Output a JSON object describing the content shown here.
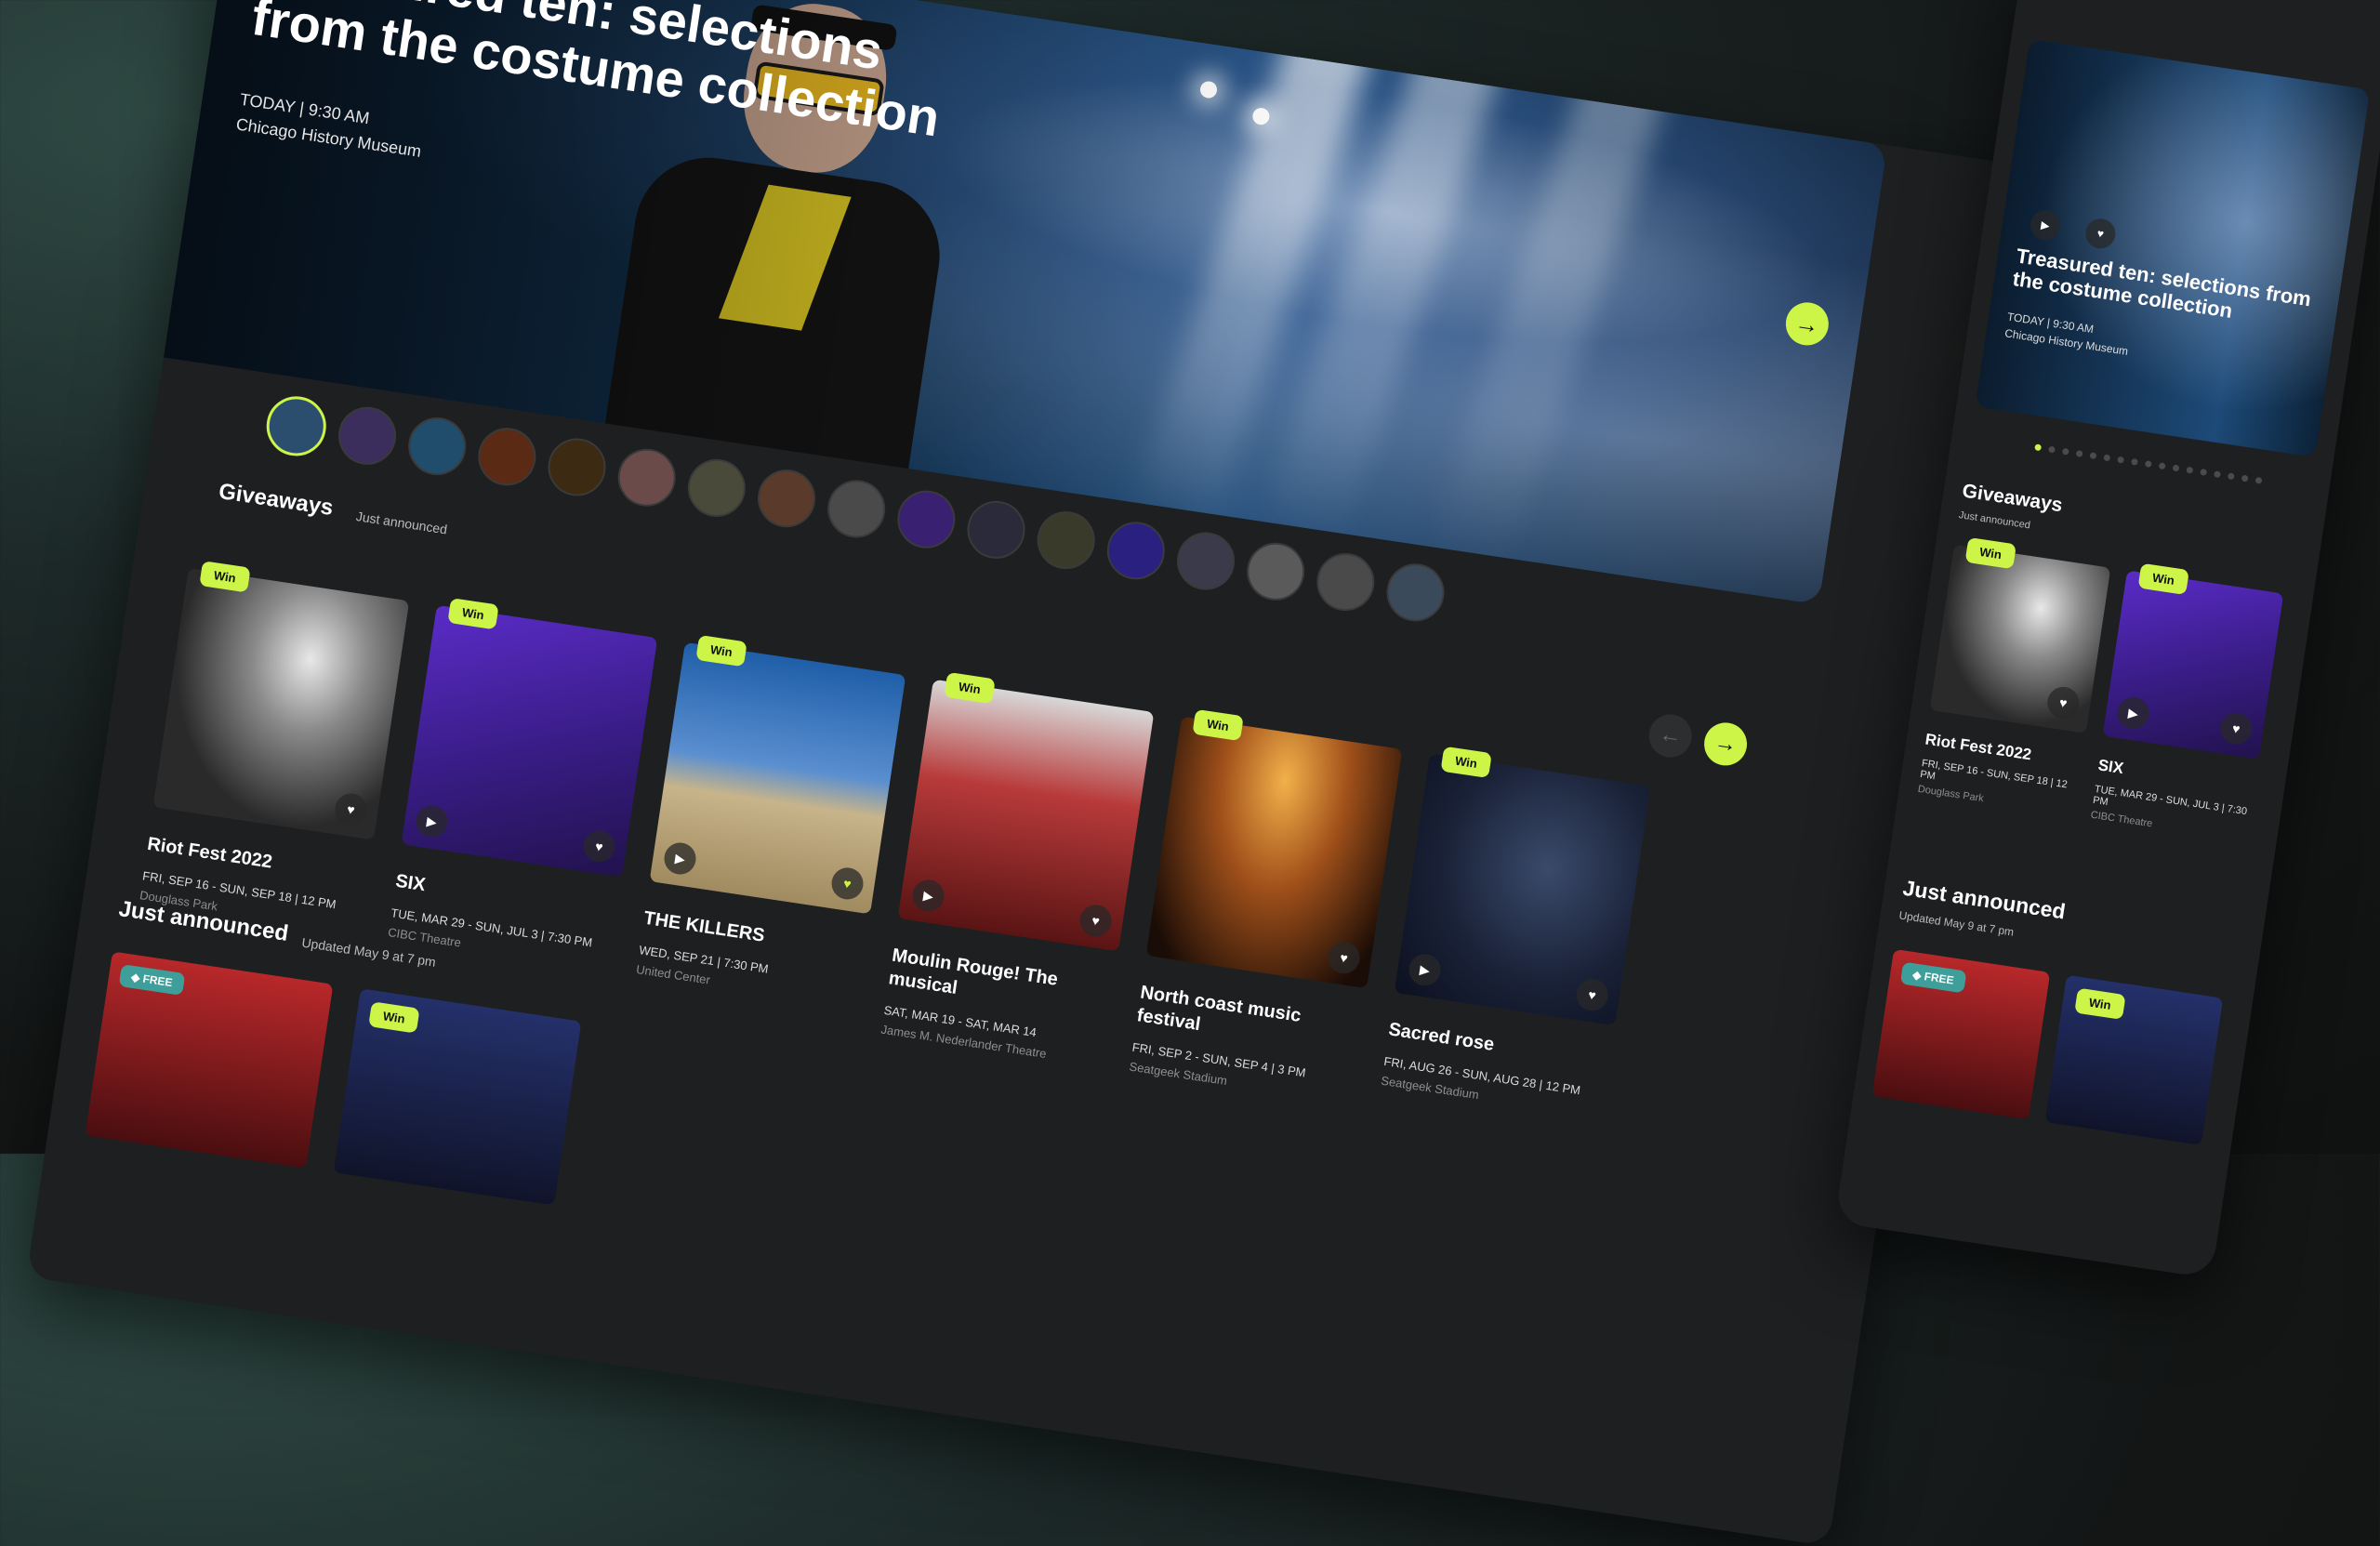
{
  "hero": {
    "title": "Treasured ten: selections from the costume collection",
    "datetime": "TODAY | 9:30 AM",
    "venue": "Chicago History Museum",
    "next_icon": "arrow-right-icon"
  },
  "giveaways": {
    "title": "Giveaways",
    "subtitle": "Just announced",
    "badge": "Win",
    "cards": [
      {
        "name": "Riot Fest 2022",
        "date": "FRI, SEP 16 - SUN, SEP 18 | 12 PM",
        "venue": "Douglass Park"
      },
      {
        "name": "SIX",
        "date": "TUE, MAR 29 - SUN, JUL 3 | 7:30 PM",
        "venue": "CIBC Theatre"
      },
      {
        "name": "THE KILLERS",
        "date": "WED, SEP 21 | 7:30 PM",
        "venue": "United Center"
      },
      {
        "name": "Moulin Rouge! The musical",
        "date": "SAT, MAR 19 - SAT, MAR 14",
        "venue": "James M. Nederlander Theatre"
      },
      {
        "name": "North coast music festival",
        "date": "FRI, SEP 2 - SUN, SEP 4 | 3 PM",
        "venue": "Seatgeek Stadium"
      },
      {
        "name": "Sacred rose",
        "date": "FRI, AUG 26 - SUN, AUG 28 | 12 PM",
        "venue": "Seatgeek Stadium"
      }
    ]
  },
  "just_announced": {
    "title": "Just announced",
    "subtitle": "Updated May 9 at 7 pm",
    "free_badge": "FREE",
    "win_badge": "Win"
  },
  "mobile": {
    "hero_title": "Treasured ten: selections from the costume collection",
    "hero_datetime": "TODAY | 9:30 AM",
    "hero_venue": "Chicago History Museum",
    "giveaways_title": "Giveaways",
    "giveaways_subtitle": "Just announced",
    "cards": [
      {
        "name": "Riot Fest 2022",
        "date": "FRI, SEP 16 - SUN, SEP 18 | 12 PM",
        "venue": "Douglass Park"
      },
      {
        "name": "SIX",
        "date": "TUE, MAR 29 - SUN, JUL 3 | 7:30 PM",
        "venue": "CIBC Theatre"
      }
    ],
    "ja_title": "Just announced",
    "ja_subtitle": "Updated May 9 at 7 pm",
    "free_badge": "FREE",
    "win_badge": "Win"
  },
  "colors": {
    "accent": "#ccf547",
    "surface": "#1e1f20",
    "free_badge": "#3d9e9a"
  },
  "icons": {
    "play": "play-icon",
    "favorite": "heart-icon",
    "next": "arrow-right-icon",
    "prev": "arrow-left-icon",
    "tag": "tag-icon"
  }
}
